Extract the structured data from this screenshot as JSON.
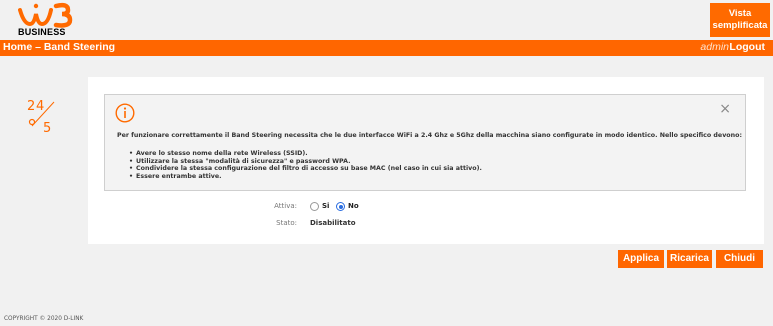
{
  "header": {
    "logo_text": "BUSINESS",
    "vista_label": "Vista semplificata"
  },
  "navbar": {
    "breadcrumb": "Home – Band Steering",
    "username": "admin",
    "logout_label": "Logout"
  },
  "alert": {
    "close_symbol": "×",
    "lead": "Per funzionare correttamente il Band Steering necessita che le due interfacce WiFi a 2.4 Ghz e 5Ghz della macchina siano configurate in modo identico. Nello specifico devono:",
    "items": [
      "Avere lo stesso nome della rete Wireless (SSID).",
      "Utilizzare la stessa \"modalità di sicurezza\" e password WPA.",
      "Condividere la stessa configurazione del filtro di accesso su base MAC (nel caso in cui sia attivo).",
      "Essere entrambe attive."
    ]
  },
  "form": {
    "attiva_label": "Attiva:",
    "option_si": "Si",
    "option_no": "No",
    "selected": "No",
    "stato_label": "Stato:",
    "stato_value": "Disabilitato"
  },
  "buttons": {
    "applica": "Applica",
    "ricarica": "Ricarica",
    "chiudi": "Chiudi"
  },
  "footer": {
    "copyright": "COPYRIGHT © 2020 D-LINK"
  },
  "colors": {
    "accent": "#ff6600",
    "radio_selected": "#2a6de0"
  }
}
